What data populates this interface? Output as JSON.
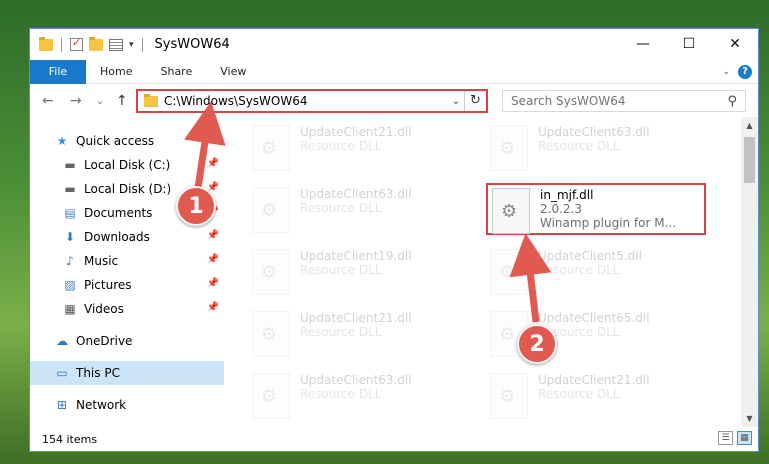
{
  "window": {
    "title": "SysWOW64",
    "minimize": "—",
    "maximize": "☐",
    "close": "✕"
  },
  "ribbon": {
    "tabs": [
      "File",
      "Home",
      "Share",
      "View"
    ],
    "expand": "⌄",
    "help": "?"
  },
  "nav": {
    "back": "←",
    "forward": "→",
    "recent": "⌄",
    "up": "↑"
  },
  "address": {
    "path": "C:\\Windows\\SysWOW64",
    "dropdown": "⌄",
    "refresh": "↻"
  },
  "search": {
    "placeholder": "Search SysWOW64",
    "icon": "⚲"
  },
  "sidebar": {
    "items": [
      {
        "label": "Quick access",
        "icon": "star-icon",
        "glyph": "★",
        "color": "#3b8ee0"
      },
      {
        "label": "Local Disk (C:)",
        "icon": "drive-icon",
        "glyph": "▬",
        "color": "#666666",
        "pinned": true
      },
      {
        "label": "Local Disk (D:)",
        "icon": "drive-icon",
        "glyph": "▬",
        "color": "#666666",
        "pinned": true
      },
      {
        "label": "Documents",
        "icon": "documents-icon",
        "glyph": "▤",
        "color": "#4a7fbf",
        "pinned": true
      },
      {
        "label": "Downloads",
        "icon": "downloads-icon",
        "glyph": "⬇",
        "color": "#2f78c4",
        "pinned": true
      },
      {
        "label": "Music",
        "icon": "music-icon",
        "glyph": "♪",
        "color": "#2f78c4",
        "pinned": true
      },
      {
        "label": "Pictures",
        "icon": "pictures-icon",
        "glyph": "▨",
        "color": "#4a7fbf",
        "pinned": true
      },
      {
        "label": "Videos",
        "icon": "videos-icon",
        "glyph": "▦",
        "color": "#555555",
        "pinned": true
      },
      {
        "label": "OneDrive",
        "icon": "onedrive-icon",
        "glyph": "☁",
        "color": "#2f78c4"
      },
      {
        "label": "This PC",
        "icon": "this-pc-icon",
        "glyph": "▭",
        "color": "#2f78c4",
        "selected": true
      },
      {
        "label": "Network",
        "icon": "network-icon",
        "glyph": "⊞",
        "color": "#2f78c4"
      }
    ],
    "pin_glyph": "📌"
  },
  "files": {
    "left": [
      {
        "name": "UpdateClient21.dll",
        "type": "Resource DLL"
      },
      {
        "name": "UpdateClient63.dll",
        "type": "Resource DLL"
      },
      {
        "name": "UpdateClient19.dll",
        "type": "Resource DLL"
      },
      {
        "name": "UpdateClient21.dll",
        "type": "Resource DLL"
      },
      {
        "name": "UpdateClient63.dll",
        "type": "Resource DLL"
      }
    ],
    "right": [
      {
        "name": "UpdateClient63.dll",
        "type": "Resource DLL"
      },
      {
        "name": "UpdateClient5.dll",
        "type": "Resource DLL"
      },
      {
        "name": "UpdateClient65.dll",
        "type": "Resource DLL"
      },
      {
        "name": "UpdateClient21.dll",
        "type": "Resource DLL"
      }
    ],
    "highlighted": {
      "name": "in_mjf.dll",
      "version": "2.0.2.3",
      "description": "Winamp plugin for M..."
    }
  },
  "status": {
    "count": "154 items",
    "details_view": "☰",
    "tiles_view": "▦"
  },
  "annotations": {
    "marker1": "1",
    "marker2": "2",
    "color": "#e05a4f"
  }
}
